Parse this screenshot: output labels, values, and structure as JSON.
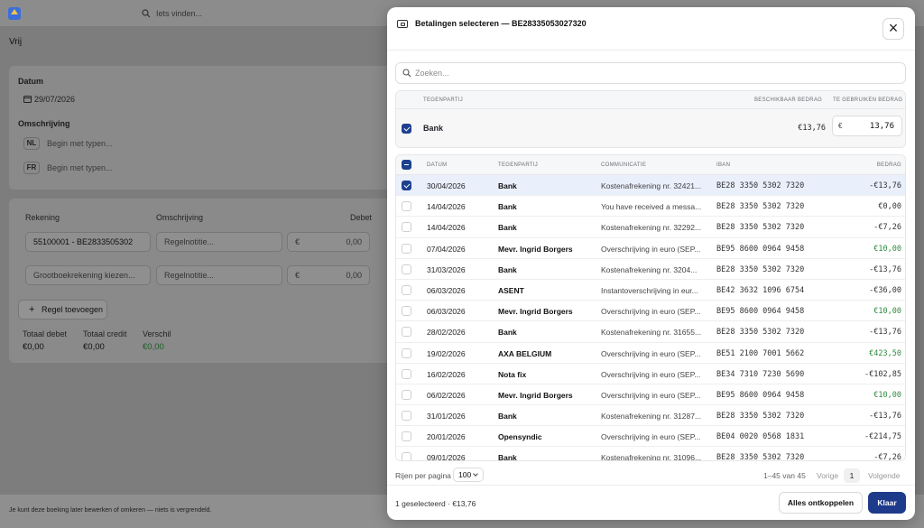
{
  "background": {
    "search_placeholder": "Iets vinden...",
    "page_title": "Vrij",
    "datum_label": "Datum",
    "datum_value": "29/07/2026",
    "omschrijving_label": "Omschrijving",
    "lang_nl": "NL",
    "lang_fr": "FR",
    "begin_placeholder": "Begin met typen...",
    "col_rekening": "Rekening",
    "col_omschrijving": "Omschrijving",
    "col_debet": "Debet",
    "line1_account": "55100001 - BE2833505302",
    "line2_account": "Grootboekrekening kiezen...",
    "regelnotitie": "Regelnotitie...",
    "euro": "€",
    "zero": "0,00",
    "add_line": "Regel toevoegen",
    "totaal_debet_label": "Totaal debet",
    "totaal_debet": "€0,00",
    "totaal_credit_label": "Totaal credit",
    "totaal_credit": "€0,00",
    "verschil_label": "Verschil",
    "verschil": "€0,00",
    "footer_note": "Je kunt deze boeking later bewerken of omkeren — niets is vergrendeld."
  },
  "modal": {
    "title": "Betalingen selecteren — BE28335053027320",
    "search_placeholder": "Zoeken...",
    "selected_table": {
      "col_tegenpartij": "TEGENPARTIJ",
      "col_beschikbaar": "BESCHIKBAAR BEDRAG",
      "col_te_gebruiken": "TE GEBRUIKEN BEDRAG",
      "party": "Bank",
      "available": "€13,76",
      "currency": "€",
      "use_amount": "13,76"
    },
    "payments": {
      "columns": {
        "datum": "DATUM",
        "tegenpartij": "TEGENPARTIJ",
        "communicatie": "COMMUNICATIE",
        "iban": "IBAN",
        "bedrag": "BEDRAG"
      },
      "rows": [
        {
          "date": "30/04/2026",
          "party": "Bank",
          "comm": "Kostenafrekening nr. 32421...",
          "iban": "BE28 3350 5302 7320",
          "amount": "-€13,76",
          "sign": "neg",
          "selected": true
        },
        {
          "date": "14/04/2026",
          "party": "Bank",
          "comm": "You have received a messa...",
          "iban": "BE28 3350 5302 7320",
          "amount": "€0,00",
          "sign": "neg",
          "selected": false
        },
        {
          "date": "14/04/2026",
          "party": "Bank",
          "comm": "Kostenafrekening nr. 32292...",
          "iban": "BE28 3350 5302 7320",
          "amount": "-€7,26",
          "sign": "neg",
          "selected": false
        },
        {
          "date": "07/04/2026",
          "party": "Mevr. Ingrid Borgers",
          "comm": "Overschrijving in euro (SEP...",
          "iban": "BE95 8600 0964 9458",
          "amount": "€10,00",
          "sign": "pos",
          "selected": false
        },
        {
          "date": "31/03/2026",
          "party": "Bank",
          "comm": "Kostenafrekening nr. 3204...",
          "iban": "BE28 3350 5302 7320",
          "amount": "-€13,76",
          "sign": "neg",
          "selected": false
        },
        {
          "date": "06/03/2026",
          "party": "ASENT",
          "comm": "Instantoverschrijving in eur...",
          "iban": "BE42 3632 1096 6754",
          "amount": "-€36,00",
          "sign": "neg",
          "selected": false
        },
        {
          "date": "06/03/2026",
          "party": "Mevr. Ingrid Borgers",
          "comm": "Overschrijving in euro (SEP...",
          "iban": "BE95 8600 0964 9458",
          "amount": "€10,00",
          "sign": "pos",
          "selected": false
        },
        {
          "date": "28/02/2026",
          "party": "Bank",
          "comm": "Kostenafrekening nr. 31655...",
          "iban": "BE28 3350 5302 7320",
          "amount": "-€13,76",
          "sign": "neg",
          "selected": false
        },
        {
          "date": "19/02/2026",
          "party": "AXA BELGIUM",
          "comm": "Overschrijving in euro (SEP...",
          "iban": "BE51 2100 7001 5662",
          "amount": "€423,50",
          "sign": "pos",
          "selected": false
        },
        {
          "date": "16/02/2026",
          "party": "Nota fix",
          "comm": "Overschrijving in euro (SEP...",
          "iban": "BE34 7310 7230 5690",
          "amount": "-€102,85",
          "sign": "neg",
          "selected": false
        },
        {
          "date": "06/02/2026",
          "party": "Mevr. Ingrid Borgers",
          "comm": "Overschrijving in euro (SEP...",
          "iban": "BE95 8600 0964 9458",
          "amount": "€10,00",
          "sign": "pos",
          "selected": false
        },
        {
          "date": "31/01/2026",
          "party": "Bank",
          "comm": "Kostenafrekening nr. 31287...",
          "iban": "BE28 3350 5302 7320",
          "amount": "-€13,76",
          "sign": "neg",
          "selected": false
        },
        {
          "date": "20/01/2026",
          "party": "Opensyndic",
          "comm": "Overschrijving in euro (SEP...",
          "iban": "BE04 0020 0568 1831",
          "amount": "-€214,75",
          "sign": "neg",
          "selected": false
        },
        {
          "date": "09/01/2026",
          "party": "Bank",
          "comm": "Kostenafrekening nr. 31096...",
          "iban": "BE28 3350 5302 7320",
          "amount": "-€7,26",
          "sign": "neg",
          "selected": false
        }
      ]
    },
    "pagination": {
      "rows_per_page_label": "Rijen per pagina",
      "rows_per_page": "100",
      "range": "1–45 van 45",
      "prev": "Vorige",
      "page": "1",
      "next": "Volgende"
    },
    "footer": {
      "status": "1 geselecteerd · €13,76",
      "unlink_all": "Alles ontkoppelen",
      "done": "Klaar"
    },
    "colors": {
      "primary": "#1e3a8a",
      "positive": "#2e8a3d",
      "selected_row": "#e9effb"
    }
  }
}
